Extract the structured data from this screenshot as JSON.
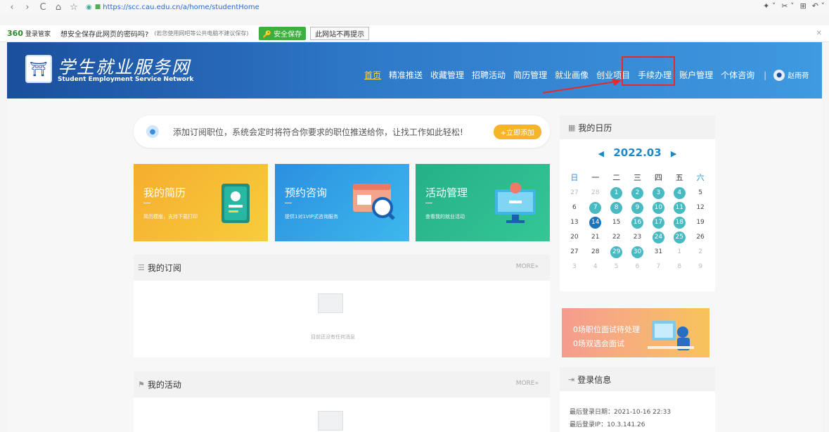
{
  "browser": {
    "url": "https://scc.cau.edu.cn/a/home/studentHome",
    "back": "‹",
    "forward": "›",
    "reload": "C",
    "home": "⌂",
    "star": "☆",
    "right_icons": [
      "✦ ˅",
      "✂ ˅",
      "⊞",
      "↶ ˅"
    ]
  },
  "password_bar": {
    "brand": "360",
    "brand_sub": "登录管家",
    "question": "想安全保存此网页的密码吗?",
    "note": "(若您使用网吧等公共电脑不建议保存)",
    "save_label": "安全保存",
    "no_label": "此网站不再提示",
    "close": "✕"
  },
  "header": {
    "title": "学生就业服务网",
    "subtitle": "Student Employment Service Network",
    "menu": [
      "首页",
      "精准推送",
      "收藏管理",
      "招聘活动",
      "简历管理",
      "就业画像",
      "创业项目",
      "手续办理",
      "账户管理",
      "个体咨询"
    ],
    "separator": "|",
    "user_name": "赵雨荷"
  },
  "subscription_banner": {
    "text": "添加订阅职位，系统会定时将符合你要求的职位推送给你，让找工作如此轻松!",
    "button": "+立即添加"
  },
  "cards": [
    {
      "title": "我的简历",
      "desc": "简历模版，支持下载打印",
      "color": "#f5b92f"
    },
    {
      "title": "预约咨询",
      "desc": "提供1对1VIP式咨询服务",
      "color": "#2b9fe0"
    },
    {
      "title": "活动管理",
      "desc": "查看我的就业活动",
      "color": "#27b39a"
    }
  ],
  "subscription_panel": {
    "title": "我的订阅",
    "more": "MORE»",
    "empty": "目前还没有任何消息"
  },
  "activity_panel": {
    "title": "我的活动",
    "more": "MORE»"
  },
  "calendar": {
    "title": "我的日历",
    "month": "2022.03",
    "weekdays": [
      "日",
      "一",
      "二",
      "三",
      "四",
      "五",
      "六"
    ],
    "weeks": [
      [
        [
          "27",
          "m"
        ],
        [
          "28",
          "m"
        ],
        [
          "1",
          "k"
        ],
        [
          "2",
          "k"
        ],
        [
          "3",
          "k"
        ],
        [
          "4",
          "k"
        ],
        [
          "5",
          ""
        ]
      ],
      [
        [
          "6",
          ""
        ],
        [
          "7",
          "k"
        ],
        [
          "8",
          "k"
        ],
        [
          "9",
          "k"
        ],
        [
          "10",
          "k"
        ],
        [
          "11",
          "k"
        ],
        [
          "12",
          ""
        ]
      ],
      [
        [
          "13",
          ""
        ],
        [
          "14",
          "t"
        ],
        [
          "15",
          ""
        ],
        [
          "16",
          "k"
        ],
        [
          "17",
          "k"
        ],
        [
          "18",
          "k"
        ],
        [
          "19",
          ""
        ]
      ],
      [
        [
          "20",
          ""
        ],
        [
          "21",
          ""
        ],
        [
          "22",
          ""
        ],
        [
          "23",
          ""
        ],
        [
          "24",
          "k"
        ],
        [
          "25",
          "k"
        ],
        [
          "26",
          ""
        ]
      ],
      [
        [
          "27",
          ""
        ],
        [
          "28",
          ""
        ],
        [
          "29",
          "k"
        ],
        [
          "30",
          "k"
        ],
        [
          "31",
          ""
        ],
        [
          "1",
          "m"
        ],
        [
          "2",
          "m"
        ]
      ],
      [
        [
          "3",
          "m"
        ],
        [
          "4",
          "m"
        ],
        [
          "5",
          "m"
        ],
        [
          "6",
          "m"
        ],
        [
          "7",
          "m"
        ],
        [
          "8",
          "m"
        ],
        [
          "9",
          "m"
        ]
      ]
    ]
  },
  "interview": {
    "line1": "0场职位面试待处理",
    "line2": "0场双选会面试"
  },
  "login_info": {
    "title": "登录信息",
    "last_date": "最后登录日期：2021-10-16 22:33",
    "last_ip": "最后登录IP：10.3.141.26"
  }
}
